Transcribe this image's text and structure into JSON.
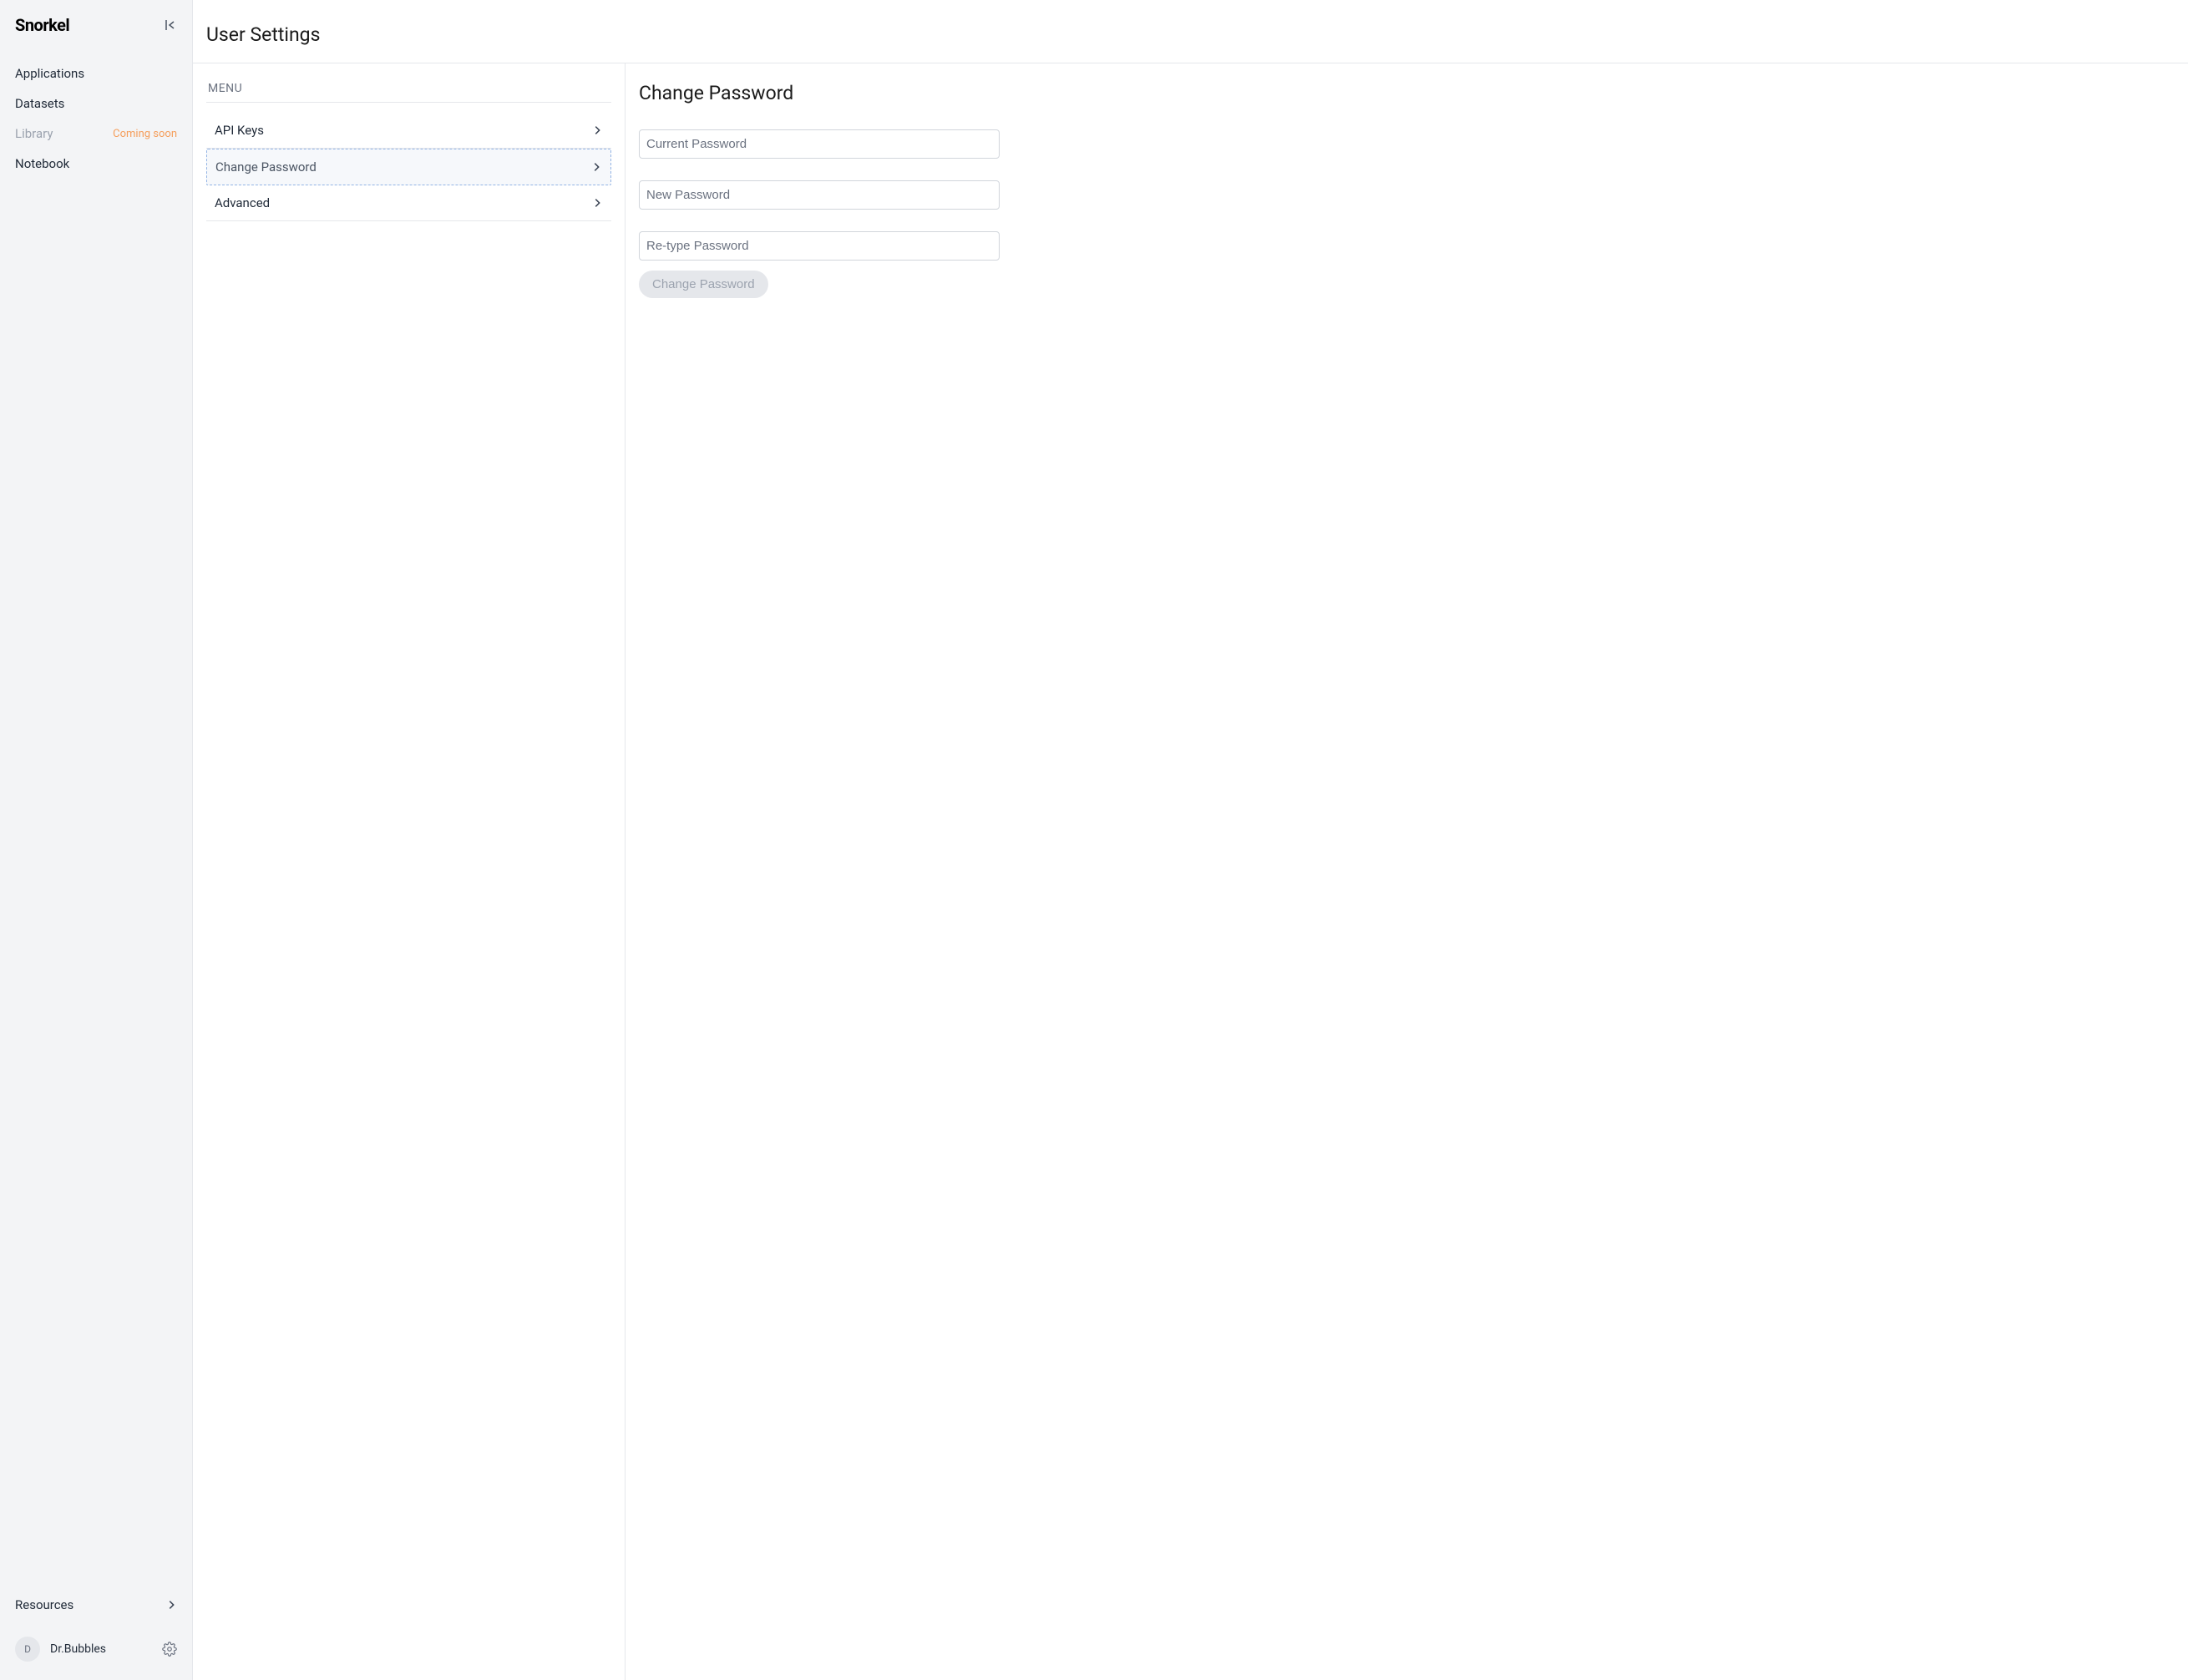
{
  "brand": "Snorkel",
  "sidebar": {
    "items": [
      {
        "label": "Applications",
        "disabled": false,
        "badge": null
      },
      {
        "label": "Datasets",
        "disabled": false,
        "badge": null
      },
      {
        "label": "Library",
        "disabled": true,
        "badge": "Coming soon"
      },
      {
        "label": "Notebook",
        "disabled": false,
        "badge": null
      }
    ],
    "resources_label": "Resources",
    "user": {
      "initial": "D",
      "name": "Dr.Bubbles"
    }
  },
  "page": {
    "title": "User Settings",
    "menu_heading": "MENU",
    "menu_items": [
      {
        "label": "API Keys",
        "active": false
      },
      {
        "label": "Change Password",
        "active": true
      },
      {
        "label": "Advanced",
        "active": false
      }
    ]
  },
  "detail": {
    "title": "Change Password",
    "fields": {
      "current_placeholder": "Current Password",
      "new_placeholder": "New Password",
      "retype_placeholder": "Re-type Password"
    },
    "submit_label": "Change Password"
  }
}
